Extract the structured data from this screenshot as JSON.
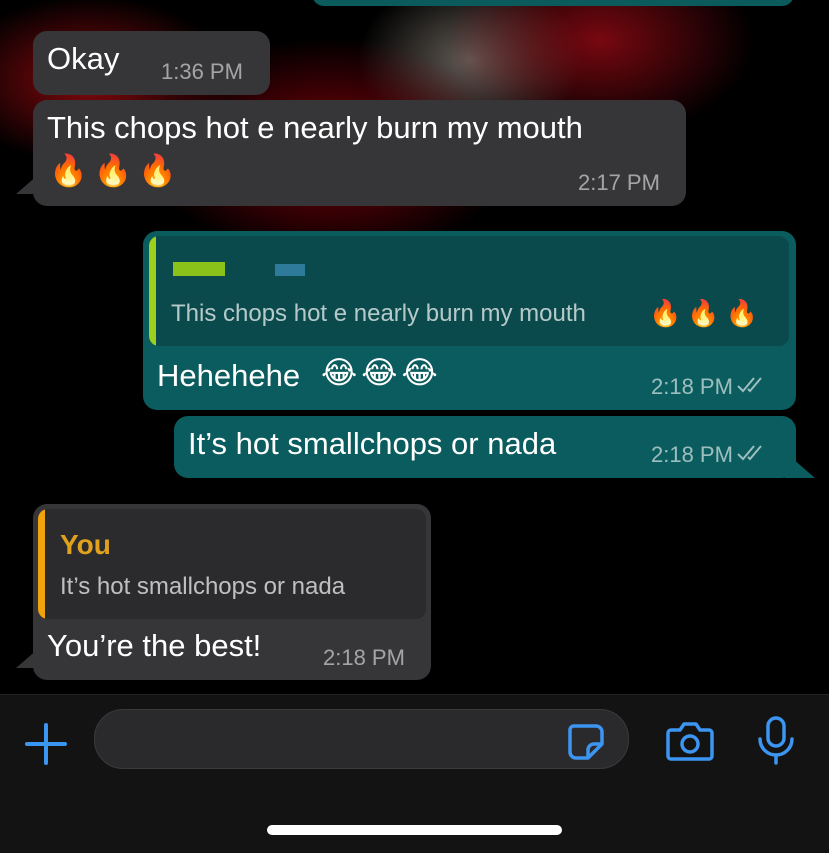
{
  "messages": [
    {
      "id": "m1",
      "direction": "incoming",
      "text": "Okay",
      "time": "1:36 PM"
    },
    {
      "id": "m2",
      "direction": "incoming",
      "text": "This chops hot e nearly burn my mouth",
      "emoji": "🔥🔥🔥",
      "time": "2:17 PM"
    },
    {
      "id": "m3",
      "direction": "outgoing",
      "quote_text": "This chops hot e nearly burn my mouth",
      "quote_emoji": "🔥🔥🔥",
      "text": "Hehehehe",
      "emoji": "😂😂😂",
      "time": "2:18 PM",
      "status": "read"
    },
    {
      "id": "m4",
      "direction": "outgoing",
      "text": "It’s hot smallchops or nada",
      "time": "2:18 PM",
      "status": "read"
    },
    {
      "id": "m5",
      "direction": "incoming",
      "quote_author": "You",
      "quote_text": "It’s hot smallchops or nada",
      "text": "You’re the best!",
      "time": "2:18 PM"
    }
  ],
  "input": {
    "placeholder": "",
    "value": ""
  },
  "icons": {
    "plus": "plus-icon",
    "sticker": "sticker-icon",
    "camera": "camera-icon",
    "mic": "microphone-icon",
    "ticks": "double-check-icon",
    "fire": "fire-emoji",
    "laugh": "tears-of-joy-emoji"
  },
  "colors": {
    "incoming_bubble": "#363638",
    "outgoing_bubble": "#0b5c5e",
    "accent_blue": "#3c95f0",
    "quote_bar_green": "#9bd01c",
    "quote_bar_you": "#f0a30a",
    "you_author": "#e0a21c",
    "background": "#000000"
  }
}
